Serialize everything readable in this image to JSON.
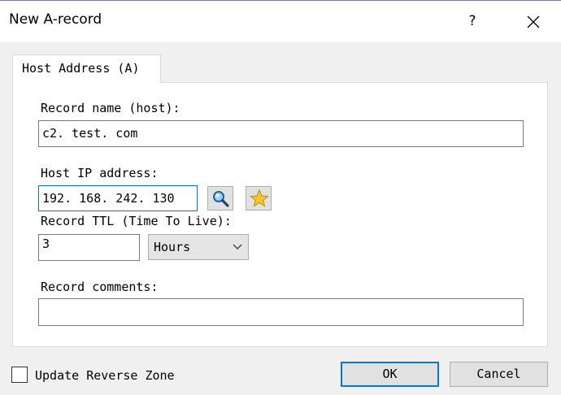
{
  "window": {
    "title": "New A-record",
    "help_label": "?"
  },
  "tab": {
    "label": "Host Address (A)"
  },
  "form": {
    "record_name_label": "Record name (host):",
    "record_name_value": "c2. test. com",
    "host_ip_label": "Host IP address:",
    "host_ip_value": "192. 168. 242. 130",
    "ttl_label": "Record TTL (Time To Live):",
    "ttl_value": "3",
    "ttl_unit": "Hours",
    "comments_label": "Record comments:",
    "comments_value": ""
  },
  "icons": {
    "browse": "magnifier-icon",
    "favorite": "star-icon",
    "close": "close-icon",
    "dropdown": "chevron-down-icon"
  },
  "footer": {
    "reverse_zone_label": "Update Reverse Zone",
    "reverse_zone_checked": false,
    "ok_label": "OK",
    "cancel_label": "Cancel"
  },
  "colors": {
    "focus_accent": "#0078d7",
    "dialog_background": "#f0f0f0"
  }
}
